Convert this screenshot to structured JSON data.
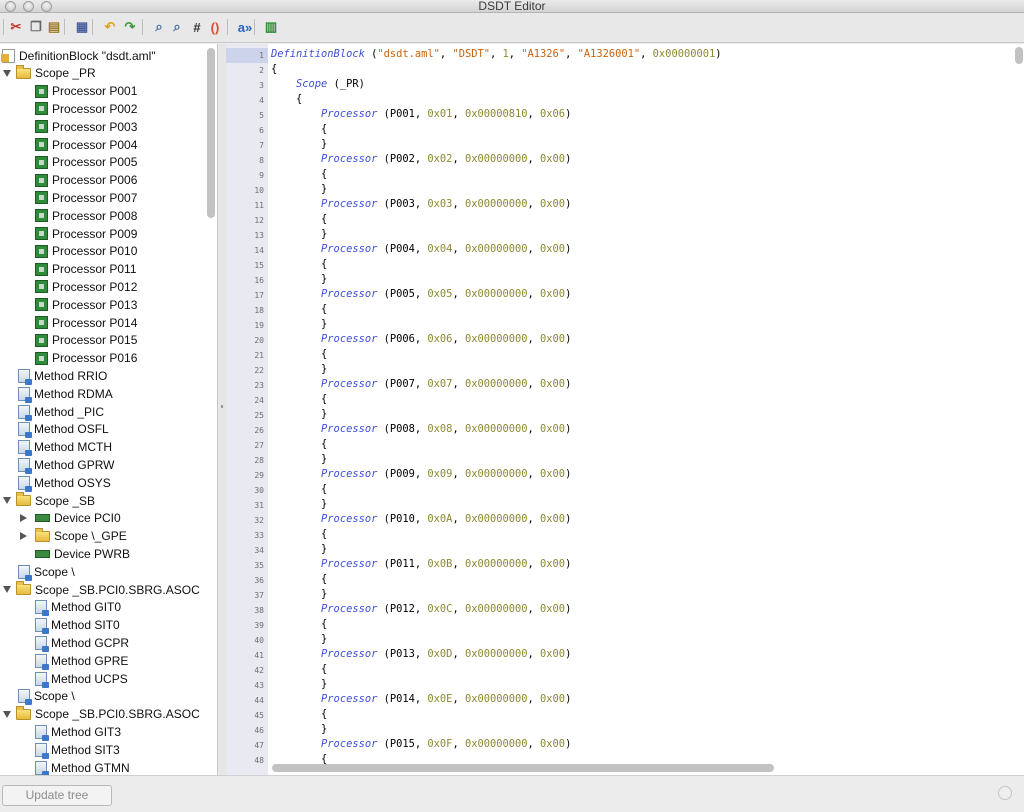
{
  "window": {
    "title": "DSDT Editor"
  },
  "toolbar": {
    "buttons": [
      {
        "name": "cut-icon",
        "glyph": "✂",
        "color": "#c0392b"
      },
      {
        "name": "copy-icon",
        "glyph": "❐",
        "color": "#666666"
      },
      {
        "name": "paste-icon",
        "glyph": "▤",
        "color": "#a07a2c"
      },
      {
        "name": "compile-icon",
        "glyph": "▦",
        "color": "#4a5fa0"
      },
      {
        "name": "undo-icon",
        "glyph": "↶",
        "color": "#d9a521"
      },
      {
        "name": "redo-icon",
        "glyph": "↷",
        "color": "#3a9a3a"
      },
      {
        "name": "find-icon",
        "glyph": "⌕",
        "color": "#4a6fa0"
      },
      {
        "name": "find-replace-icon",
        "glyph": "⌕",
        "color": "#4a6fa0"
      },
      {
        "name": "hash-icon",
        "glyph": "#",
        "color": "#333333"
      },
      {
        "name": "brackets-icon",
        "glyph": "()",
        "color": "#d4502c"
      },
      {
        "name": "replace-text-icon",
        "glyph": "a»",
        "color": "#2a64c4"
      },
      {
        "name": "patch-icon",
        "glyph": "▥",
        "color": "#2f8a3a"
      }
    ]
  },
  "tree": {
    "items": [
      {
        "label": "DefinitionBlock \"dsdt.aml\"",
        "icon": "defblock-icon",
        "indent": 0,
        "arrow": "none"
      },
      {
        "label": "Scope _PR",
        "icon": "folder-icon",
        "indent": 0,
        "arrow": "down"
      },
      {
        "label": "Processor P001",
        "icon": "cpu-icon",
        "indent": 2,
        "arrow": "none"
      },
      {
        "label": "Processor P002",
        "icon": "cpu-icon",
        "indent": 2,
        "arrow": "none"
      },
      {
        "label": "Processor P003",
        "icon": "cpu-icon",
        "indent": 2,
        "arrow": "none"
      },
      {
        "label": "Processor P004",
        "icon": "cpu-icon",
        "indent": 2,
        "arrow": "none"
      },
      {
        "label": "Processor P005",
        "icon": "cpu-icon",
        "indent": 2,
        "arrow": "none"
      },
      {
        "label": "Processor P006",
        "icon": "cpu-icon",
        "indent": 2,
        "arrow": "none"
      },
      {
        "label": "Processor P007",
        "icon": "cpu-icon",
        "indent": 2,
        "arrow": "none"
      },
      {
        "label": "Processor P008",
        "icon": "cpu-icon",
        "indent": 2,
        "arrow": "none"
      },
      {
        "label": "Processor P009",
        "icon": "cpu-icon",
        "indent": 2,
        "arrow": "none"
      },
      {
        "label": "Processor P010",
        "icon": "cpu-icon",
        "indent": 2,
        "arrow": "none"
      },
      {
        "label": "Processor P011",
        "icon": "cpu-icon",
        "indent": 2,
        "arrow": "none"
      },
      {
        "label": "Processor P012",
        "icon": "cpu-icon",
        "indent": 2,
        "arrow": "none"
      },
      {
        "label": "Processor P013",
        "icon": "cpu-icon",
        "indent": 2,
        "arrow": "none"
      },
      {
        "label": "Processor P014",
        "icon": "cpu-icon",
        "indent": 2,
        "arrow": "none"
      },
      {
        "label": "Processor P015",
        "icon": "cpu-icon",
        "indent": 2,
        "arrow": "none"
      },
      {
        "label": "Processor P016",
        "icon": "cpu-icon",
        "indent": 2,
        "arrow": "none"
      },
      {
        "label": "Method RRIO",
        "icon": "method-icon",
        "indent": 1,
        "arrow": "none"
      },
      {
        "label": "Method RDMA",
        "icon": "method-icon",
        "indent": 1,
        "arrow": "none"
      },
      {
        "label": "Method _PIC",
        "icon": "method-icon",
        "indent": 1,
        "arrow": "none"
      },
      {
        "label": "Method OSFL",
        "icon": "method-icon",
        "indent": 1,
        "arrow": "none"
      },
      {
        "label": "Method MCTH",
        "icon": "method-icon",
        "indent": 1,
        "arrow": "none"
      },
      {
        "label": "Method GPRW",
        "icon": "method-icon",
        "indent": 1,
        "arrow": "none"
      },
      {
        "label": "Method OSYS",
        "icon": "method-icon",
        "indent": 1,
        "arrow": "none"
      },
      {
        "label": "Scope _SB",
        "icon": "folder-icon",
        "indent": 0,
        "arrow": "down"
      },
      {
        "label": "Device PCI0",
        "icon": "device-icon",
        "indent": 2,
        "arrow": "right"
      },
      {
        "label": "Scope \\_GPE",
        "icon": "folder-icon",
        "indent": 2,
        "arrow": "right"
      },
      {
        "label": "Device PWRB",
        "icon": "device-icon",
        "indent": 2,
        "arrow": "none"
      },
      {
        "label": "Scope \\",
        "icon": "method-icon",
        "indent": 1,
        "arrow": "none"
      },
      {
        "label": "Scope _SB.PCI0.SBRG.ASOC",
        "icon": "folder-icon",
        "indent": 0,
        "arrow": "down"
      },
      {
        "label": "Method GIT0",
        "icon": "method-icon",
        "indent": 2,
        "arrow": "none"
      },
      {
        "label": "Method SIT0",
        "icon": "method-icon",
        "indent": 2,
        "arrow": "none"
      },
      {
        "label": "Method GCPR",
        "icon": "method-icon",
        "indent": 2,
        "arrow": "none"
      },
      {
        "label": "Method GPRE",
        "icon": "method-icon",
        "indent": 2,
        "arrow": "none"
      },
      {
        "label": "Method UCPS",
        "icon": "method-icon",
        "indent": 2,
        "arrow": "none"
      },
      {
        "label": "Scope \\",
        "icon": "method-icon",
        "indent": 1,
        "arrow": "none"
      },
      {
        "label": "Scope _SB.PCI0.SBRG.ASOC",
        "icon": "folder-icon",
        "indent": 0,
        "arrow": "down"
      },
      {
        "label": "Method GIT3",
        "icon": "method-icon",
        "indent": 2,
        "arrow": "none"
      },
      {
        "label": "Method SIT3",
        "icon": "method-icon",
        "indent": 2,
        "arrow": "none"
      },
      {
        "label": "Method GTMN",
        "icon": "method-icon",
        "indent": 2,
        "arrow": "none"
      }
    ]
  },
  "editor": {
    "lines": [
      [
        {
          "t": "kw",
          "v": "DefinitionBlock"
        },
        {
          "t": "p",
          "v": " ("
        },
        {
          "t": "str",
          "v": "\"dsdt.aml\""
        },
        {
          "t": "p",
          "v": ", "
        },
        {
          "t": "str",
          "v": "\"DSDT\""
        },
        {
          "t": "p",
          "v": ", "
        },
        {
          "t": "num",
          "v": "1"
        },
        {
          "t": "p",
          "v": ", "
        },
        {
          "t": "str",
          "v": "\"A1326\""
        },
        {
          "t": "p",
          "v": ", "
        },
        {
          "t": "str",
          "v": "\"A1326001\""
        },
        {
          "t": "p",
          "v": ", "
        },
        {
          "t": "num",
          "v": "0x00000001"
        },
        {
          "t": "p",
          "v": ")"
        }
      ],
      [
        {
          "t": "p",
          "v": "{"
        }
      ],
      [
        {
          "t": "p",
          "v": "    "
        },
        {
          "t": "kw",
          "v": "Scope"
        },
        {
          "t": "p",
          "v": " (_PR)"
        }
      ],
      [
        {
          "t": "p",
          "v": "    {"
        }
      ],
      [
        {
          "t": "p",
          "v": "        "
        },
        {
          "t": "kw",
          "v": "Processor"
        },
        {
          "t": "p",
          "v": " (P001, "
        },
        {
          "t": "num",
          "v": "0x01"
        },
        {
          "t": "p",
          "v": ", "
        },
        {
          "t": "num",
          "v": "0x00000810"
        },
        {
          "t": "p",
          "v": ", "
        },
        {
          "t": "num",
          "v": "0x06"
        },
        {
          "t": "p",
          "v": ")"
        }
      ],
      [
        {
          "t": "p",
          "v": "        {"
        }
      ],
      [
        {
          "t": "p",
          "v": "        }"
        }
      ],
      [
        {
          "t": "p",
          "v": "        "
        },
        {
          "t": "kw",
          "v": "Processor"
        },
        {
          "t": "p",
          "v": " (P002, "
        },
        {
          "t": "num",
          "v": "0x02"
        },
        {
          "t": "p",
          "v": ", "
        },
        {
          "t": "num",
          "v": "0x00000000"
        },
        {
          "t": "p",
          "v": ", "
        },
        {
          "t": "num",
          "v": "0x00"
        },
        {
          "t": "p",
          "v": ")"
        }
      ],
      [
        {
          "t": "p",
          "v": "        {"
        }
      ],
      [
        {
          "t": "p",
          "v": "        }"
        }
      ],
      [
        {
          "t": "p",
          "v": "        "
        },
        {
          "t": "kw",
          "v": "Processor"
        },
        {
          "t": "p",
          "v": " (P003, "
        },
        {
          "t": "num",
          "v": "0x03"
        },
        {
          "t": "p",
          "v": ", "
        },
        {
          "t": "num",
          "v": "0x00000000"
        },
        {
          "t": "p",
          "v": ", "
        },
        {
          "t": "num",
          "v": "0x00"
        },
        {
          "t": "p",
          "v": ")"
        }
      ],
      [
        {
          "t": "p",
          "v": "        {"
        }
      ],
      [
        {
          "t": "p",
          "v": "        }"
        }
      ],
      [
        {
          "t": "p",
          "v": "        "
        },
        {
          "t": "kw",
          "v": "Processor"
        },
        {
          "t": "p",
          "v": " (P004, "
        },
        {
          "t": "num",
          "v": "0x04"
        },
        {
          "t": "p",
          "v": ", "
        },
        {
          "t": "num",
          "v": "0x00000000"
        },
        {
          "t": "p",
          "v": ", "
        },
        {
          "t": "num",
          "v": "0x00"
        },
        {
          "t": "p",
          "v": ")"
        }
      ],
      [
        {
          "t": "p",
          "v": "        {"
        }
      ],
      [
        {
          "t": "p",
          "v": "        }"
        }
      ],
      [
        {
          "t": "p",
          "v": "        "
        },
        {
          "t": "kw",
          "v": "Processor"
        },
        {
          "t": "p",
          "v": " (P005, "
        },
        {
          "t": "num",
          "v": "0x05"
        },
        {
          "t": "p",
          "v": ", "
        },
        {
          "t": "num",
          "v": "0x00000000"
        },
        {
          "t": "p",
          "v": ", "
        },
        {
          "t": "num",
          "v": "0x00"
        },
        {
          "t": "p",
          "v": ")"
        }
      ],
      [
        {
          "t": "p",
          "v": "        {"
        }
      ],
      [
        {
          "t": "p",
          "v": "        }"
        }
      ],
      [
        {
          "t": "p",
          "v": "        "
        },
        {
          "t": "kw",
          "v": "Processor"
        },
        {
          "t": "p",
          "v": " (P006, "
        },
        {
          "t": "num",
          "v": "0x06"
        },
        {
          "t": "p",
          "v": ", "
        },
        {
          "t": "num",
          "v": "0x00000000"
        },
        {
          "t": "p",
          "v": ", "
        },
        {
          "t": "num",
          "v": "0x00"
        },
        {
          "t": "p",
          "v": ")"
        }
      ],
      [
        {
          "t": "p",
          "v": "        {"
        }
      ],
      [
        {
          "t": "p",
          "v": "        }"
        }
      ],
      [
        {
          "t": "p",
          "v": "        "
        },
        {
          "t": "kw",
          "v": "Processor"
        },
        {
          "t": "p",
          "v": " (P007, "
        },
        {
          "t": "num",
          "v": "0x07"
        },
        {
          "t": "p",
          "v": ", "
        },
        {
          "t": "num",
          "v": "0x00000000"
        },
        {
          "t": "p",
          "v": ", "
        },
        {
          "t": "num",
          "v": "0x00"
        },
        {
          "t": "p",
          "v": ")"
        }
      ],
      [
        {
          "t": "p",
          "v": "        {"
        }
      ],
      [
        {
          "t": "p",
          "v": "        }"
        }
      ],
      [
        {
          "t": "p",
          "v": "        "
        },
        {
          "t": "kw",
          "v": "Processor"
        },
        {
          "t": "p",
          "v": " (P008, "
        },
        {
          "t": "num",
          "v": "0x08"
        },
        {
          "t": "p",
          "v": ", "
        },
        {
          "t": "num",
          "v": "0x00000000"
        },
        {
          "t": "p",
          "v": ", "
        },
        {
          "t": "num",
          "v": "0x00"
        },
        {
          "t": "p",
          "v": ")"
        }
      ],
      [
        {
          "t": "p",
          "v": "        {"
        }
      ],
      [
        {
          "t": "p",
          "v": "        }"
        }
      ],
      [
        {
          "t": "p",
          "v": "        "
        },
        {
          "t": "kw",
          "v": "Processor"
        },
        {
          "t": "p",
          "v": " (P009, "
        },
        {
          "t": "num",
          "v": "0x09"
        },
        {
          "t": "p",
          "v": ", "
        },
        {
          "t": "num",
          "v": "0x00000000"
        },
        {
          "t": "p",
          "v": ", "
        },
        {
          "t": "num",
          "v": "0x00"
        },
        {
          "t": "p",
          "v": ")"
        }
      ],
      [
        {
          "t": "p",
          "v": "        {"
        }
      ],
      [
        {
          "t": "p",
          "v": "        }"
        }
      ],
      [
        {
          "t": "p",
          "v": "        "
        },
        {
          "t": "kw",
          "v": "Processor"
        },
        {
          "t": "p",
          "v": " (P010, "
        },
        {
          "t": "num",
          "v": "0x0A"
        },
        {
          "t": "p",
          "v": ", "
        },
        {
          "t": "num",
          "v": "0x00000000"
        },
        {
          "t": "p",
          "v": ", "
        },
        {
          "t": "num",
          "v": "0x00"
        },
        {
          "t": "p",
          "v": ")"
        }
      ],
      [
        {
          "t": "p",
          "v": "        {"
        }
      ],
      [
        {
          "t": "p",
          "v": "        }"
        }
      ],
      [
        {
          "t": "p",
          "v": "        "
        },
        {
          "t": "kw",
          "v": "Processor"
        },
        {
          "t": "p",
          "v": " (P011, "
        },
        {
          "t": "num",
          "v": "0x0B"
        },
        {
          "t": "p",
          "v": ", "
        },
        {
          "t": "num",
          "v": "0x00000000"
        },
        {
          "t": "p",
          "v": ", "
        },
        {
          "t": "num",
          "v": "0x00"
        },
        {
          "t": "p",
          "v": ")"
        }
      ],
      [
        {
          "t": "p",
          "v": "        {"
        }
      ],
      [
        {
          "t": "p",
          "v": "        }"
        }
      ],
      [
        {
          "t": "p",
          "v": "        "
        },
        {
          "t": "kw",
          "v": "Processor"
        },
        {
          "t": "p",
          "v": " (P012, "
        },
        {
          "t": "num",
          "v": "0x0C"
        },
        {
          "t": "p",
          "v": ", "
        },
        {
          "t": "num",
          "v": "0x00000000"
        },
        {
          "t": "p",
          "v": ", "
        },
        {
          "t": "num",
          "v": "0x00"
        },
        {
          "t": "p",
          "v": ")"
        }
      ],
      [
        {
          "t": "p",
          "v": "        {"
        }
      ],
      [
        {
          "t": "p",
          "v": "        }"
        }
      ],
      [
        {
          "t": "p",
          "v": "        "
        },
        {
          "t": "kw",
          "v": "Processor"
        },
        {
          "t": "p",
          "v": " (P013, "
        },
        {
          "t": "num",
          "v": "0x0D"
        },
        {
          "t": "p",
          "v": ", "
        },
        {
          "t": "num",
          "v": "0x00000000"
        },
        {
          "t": "p",
          "v": ", "
        },
        {
          "t": "num",
          "v": "0x00"
        },
        {
          "t": "p",
          "v": ")"
        }
      ],
      [
        {
          "t": "p",
          "v": "        {"
        }
      ],
      [
        {
          "t": "p",
          "v": "        }"
        }
      ],
      [
        {
          "t": "p",
          "v": "        "
        },
        {
          "t": "kw",
          "v": "Processor"
        },
        {
          "t": "p",
          "v": " (P014, "
        },
        {
          "t": "num",
          "v": "0x0E"
        },
        {
          "t": "p",
          "v": ", "
        },
        {
          "t": "num",
          "v": "0x00000000"
        },
        {
          "t": "p",
          "v": ", "
        },
        {
          "t": "num",
          "v": "0x00"
        },
        {
          "t": "p",
          "v": ")"
        }
      ],
      [
        {
          "t": "p",
          "v": "        {"
        }
      ],
      [
        {
          "t": "p",
          "v": "        }"
        }
      ],
      [
        {
          "t": "p",
          "v": "        "
        },
        {
          "t": "kw",
          "v": "Processor"
        },
        {
          "t": "p",
          "v": " (P015, "
        },
        {
          "t": "num",
          "v": "0x0F"
        },
        {
          "t": "p",
          "v": ", "
        },
        {
          "t": "num",
          "v": "0x00000000"
        },
        {
          "t": "p",
          "v": ", "
        },
        {
          "t": "num",
          "v": "0x00"
        },
        {
          "t": "p",
          "v": ")"
        }
      ],
      [
        {
          "t": "p",
          "v": "        {"
        }
      ]
    ]
  },
  "bottom": {
    "update_label": "Update tree"
  }
}
